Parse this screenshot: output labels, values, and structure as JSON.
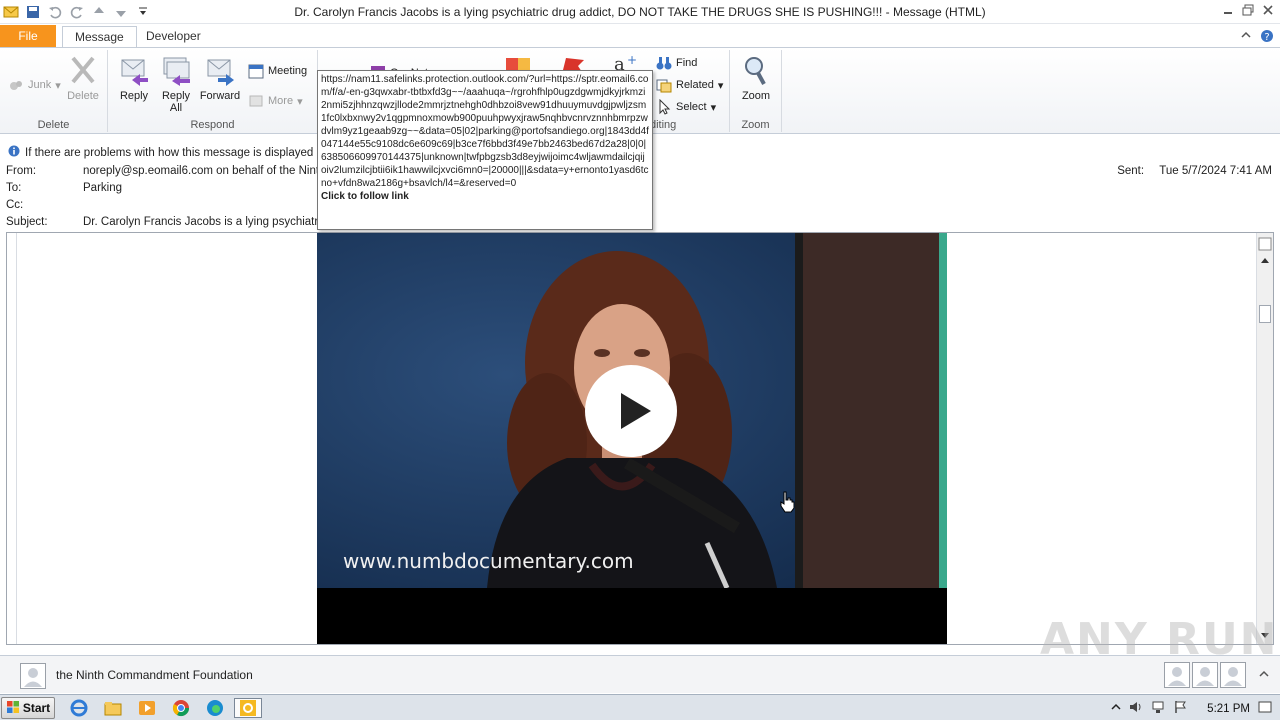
{
  "window": {
    "title": "Dr. Carolyn Francis Jacobs is a lying psychiatric drug addict, DO NOT TAKE THE DRUGS SHE IS PUSHING!!! - Message (HTML)"
  },
  "tabs": {
    "file": "File",
    "message": "Message",
    "developer": "Developer"
  },
  "ribbon": {
    "delete_group": {
      "label": "Delete",
      "junk": "Junk",
      "delete": "Delete"
    },
    "respond_group": {
      "label": "Respond",
      "reply": "Reply",
      "reply_all_1": "Reply",
      "reply_all_2": "All",
      "forward": "Forward",
      "meeting": "Meeting",
      "more": "More"
    },
    "partial_onenote": "OneNote",
    "editing_group": {
      "label": "Editing",
      "label_visible": "diting",
      "find": "Find",
      "related": "Related",
      "select": "Select"
    },
    "zoom_group": {
      "label": "Zoom",
      "zoom": "Zoom"
    }
  },
  "infobar": {
    "text": "If there are problems with how this message is displayed"
  },
  "header": {
    "from_label": "From:",
    "from_value": "noreply@sp.eomail6.com on behalf of the Ninth C",
    "to_label": "To:",
    "to_value": "Parking",
    "cc_label": "Cc:",
    "cc_value": "",
    "subject_label": "Subject:",
    "subject_value": "Dr. Carolyn Francis Jacobs is a lying psychiatri",
    "sent_label": "Sent:",
    "sent_value": "Tue 5/7/2024 7:41 AM"
  },
  "tooltip": {
    "url": "https://nam11.safelinks.protection.outlook.com/?url=https://sptr.eomail6.com/f/a/-en-g3qwxabr-tbtbxfd3g~~/aaahuqa~/rgrohfhlp0ugzdgwmjdkyjrkmzi2nmi5zjhhnzqwzjllode2mmrjztnehgh0dhbzoi8vew91dhuuymuvdgjpwljzsm1fc0lxbxnwy2v1qgpmnoxmowb900puuhpwyxjraw5nqhbvcnrvznnhbmrpzwdvlm9yz1geaab9zg~~&data=05|02|parking@portofsandiego.org|1843dd4f047144e55c9108dc6e609c69|b3ce7f6bbd3f49e7bb2463bed67d2a28|0|0|638506609970144375|unknown|twfpbgzsb3d8eyjwijoimc4wljawmdailcjqijoiv2lumzilcjbtii6ik1hawwilcjxvci6mn0=|20000|||&sdata=y+ernonto1yasd6tcno+vfdn8wa2186g+bsavlch/l4=&reserved=0",
    "action": "Click to follow link"
  },
  "video": {
    "caption": "www.numbdocumentary.com"
  },
  "people_pane": {
    "name": "the Ninth Commandment Foundation"
  },
  "taskbar": {
    "start": "Start",
    "clock": "5:21 PM"
  },
  "watermark": "ANY RUN",
  "colors": {
    "file_tab": "#f7941d",
    "ribbon_bg": "#f1f3f6",
    "taskbar": "#dde3ea"
  }
}
